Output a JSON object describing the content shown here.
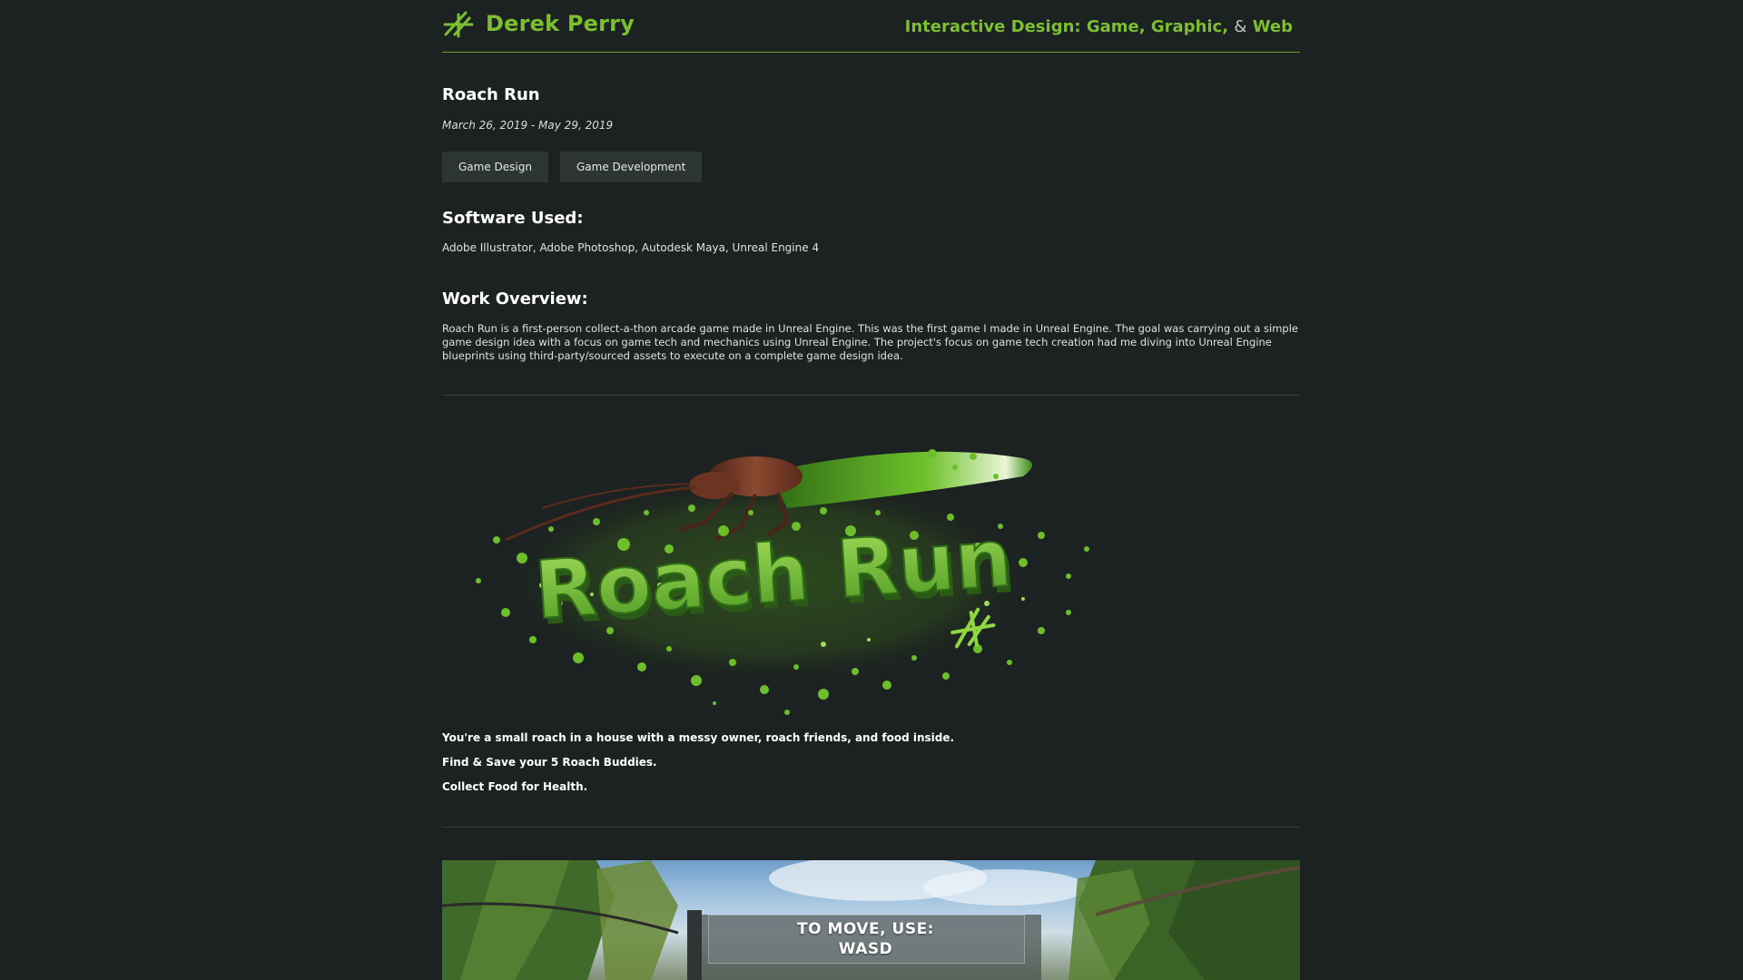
{
  "header": {
    "brand_name": "Derek Perry",
    "tagline_prefix": "Interactive Design:",
    "tagline_game": "Game,",
    "tagline_graphic": "Graphic,",
    "tagline_amp": "&",
    "tagline_web": "Web",
    "logo_icon": "dp-monogram-icon"
  },
  "project": {
    "title": "Roach Run",
    "date": "March 26, 2019 - May 29, 2019",
    "tags": [
      "Game Design",
      "Game Development"
    ]
  },
  "software": {
    "heading": "Software Used:",
    "text": "Adobe Illustrator, Adobe Photoshop, Autodesk Maya, Unreal Engine 4"
  },
  "overview": {
    "heading": "Work Overview:",
    "text": "Roach Run is a first-person collect-a-thon arcade game made in Unreal Engine. This was the first game I made in Unreal Engine. The goal was carrying out a simple game design idea with a focus on game tech and mechanics using Unreal Engine. The project's focus on game tech creation had me diving into Unreal Engine blueprints using third-party/sourced assets to execute on a complete game design idea."
  },
  "logo_art": {
    "text": "Roach Run",
    "accent": "#7cbf2f"
  },
  "bullets": [
    "You're a small roach in a house with a messy owner, roach friends, and food inside.",
    "Find & Save your 5 Roach Buddies.",
    "Collect Food for Health."
  ],
  "screenshot": {
    "hint_line_1": "TO MOVE, USE:",
    "hint_line_2": "WASD"
  },
  "colors": {
    "background": "#1c2221",
    "accent": "#7cbf2f",
    "tag_bg": "#2d3534"
  }
}
